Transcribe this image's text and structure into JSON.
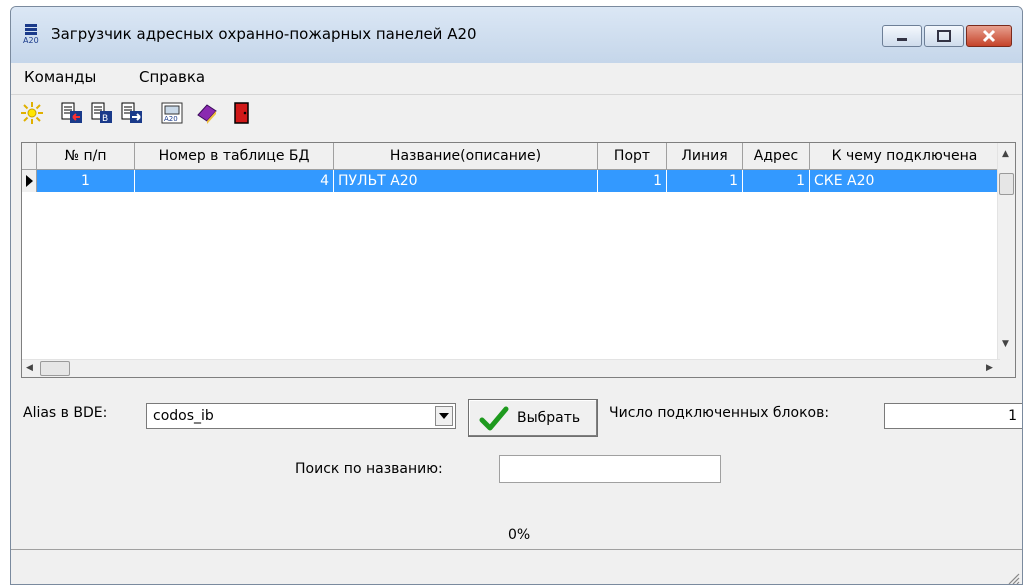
{
  "window": {
    "title": "Загрузчик адресных охранно-пожарных панелей А20"
  },
  "menu": [
    {
      "label": "Команды"
    },
    {
      "label": "Справка"
    }
  ],
  "toolbar": {
    "icons": [
      "sun-new-icon",
      "load-from-panel-icon",
      "load-to-panel-icon",
      "copy-panel-icon",
      "a20-panel-icon",
      "help-book-icon",
      "exit-door-icon"
    ]
  },
  "table": {
    "columns": [
      "№ п/п",
      "Номер в таблице БД",
      "Название(описание)",
      "Порт",
      "Линия",
      "Адрес",
      "К чему подключена"
    ],
    "rows": [
      [
        "1",
        "4",
        "ПУЛЬТ А20",
        "1",
        "1",
        "1",
        "СКЕ А20"
      ]
    ]
  },
  "form": {
    "alias_label": "Alias в BDE:",
    "alias_value": "codos_ib",
    "select_button": "Выбрать",
    "blocks_label": "Число подключенных блоков:",
    "blocks_value": "1",
    "search_label": "Поиск по названию:",
    "search_value": "",
    "progress_text": "0%"
  },
  "colors": {
    "selection": "#3399ff",
    "titlebar": "#c5d6ea",
    "close_button": "#c5432a"
  }
}
